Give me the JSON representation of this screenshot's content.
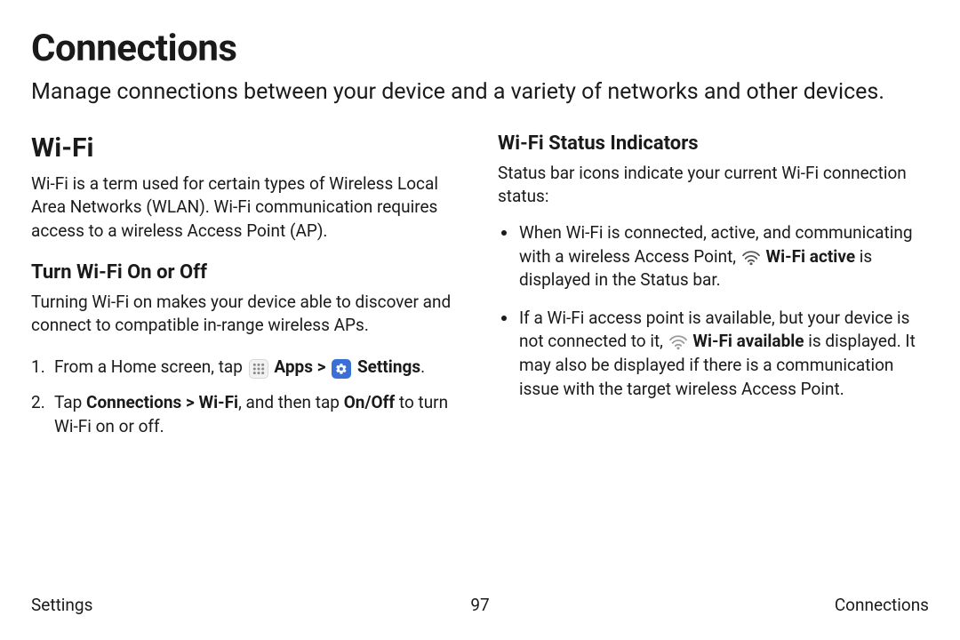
{
  "page": {
    "title": "Connections",
    "subtitle": "Manage connections between your device and a variety of networks and other devices."
  },
  "left": {
    "heading": "Wi-Fi",
    "intro": "Wi-Fi is a term used for certain types of Wireless Local Area Networks (WLAN). Wi-Fi communication requires access to a wireless Access Point (AP).",
    "sub_heading": "Turn Wi-Fi On or Off",
    "sub_intro": "Turning Wi-Fi on makes your device able to discover and connect to compatible in-range wireless APs.",
    "step1_a": "From a Home screen, tap ",
    "step1_apps": " Apps",
    "step1_sep": " > ",
    "step1_settings": " Settings",
    "step1_end": ".",
    "step2_a": "Tap ",
    "step2_b": "Connections > Wi-Fi",
    "step2_c": ", and then tap ",
    "step2_d": "On/Off",
    "step2_e": " to turn Wi-Fi on or off."
  },
  "right": {
    "heading": "Wi-Fi Status Indicators",
    "intro": "Status bar icons indicate your current Wi-Fi connection status:",
    "b1_a": "When Wi-Fi is connected, active, and communicating with a wireless Access Point, ",
    "b1_b": " Wi-Fi active",
    "b1_c": " is displayed in the Status bar.",
    "b2_a": "If a Wi-Fi access point is available, but your device is not connected to it, ",
    "b2_b": " Wi-Fi available",
    "b2_c": " is displayed. It may also be displayed if there is a communication issue with the target wireless Access Point."
  },
  "footer": {
    "left": "Settings",
    "center": "97",
    "right": "Connections"
  }
}
